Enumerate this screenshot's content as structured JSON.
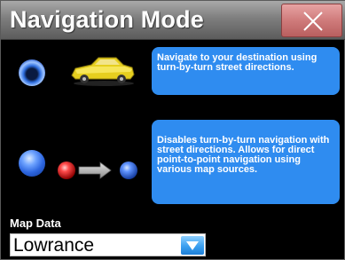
{
  "window": {
    "title": "Navigation Mode"
  },
  "options": [
    {
      "id": "turn-by-turn",
      "selected": true,
      "icon": "car-icon",
      "description": "Navigate to your destination using turn-by-turn street directions."
    },
    {
      "id": "point-to-point",
      "selected": false,
      "icon": "point-to-point-route-icon",
      "description": "Disables turn-by-turn navigation with street directions. Allows for direct point-to-point navigation using various map sources."
    }
  ],
  "map_data": {
    "label": "Map Data",
    "value": "Lowrance"
  },
  "colors": {
    "accent_blue": "#2f8cf0",
    "titlebar_gray": "#7e7e7e",
    "close_red": "#cf7b7b"
  }
}
